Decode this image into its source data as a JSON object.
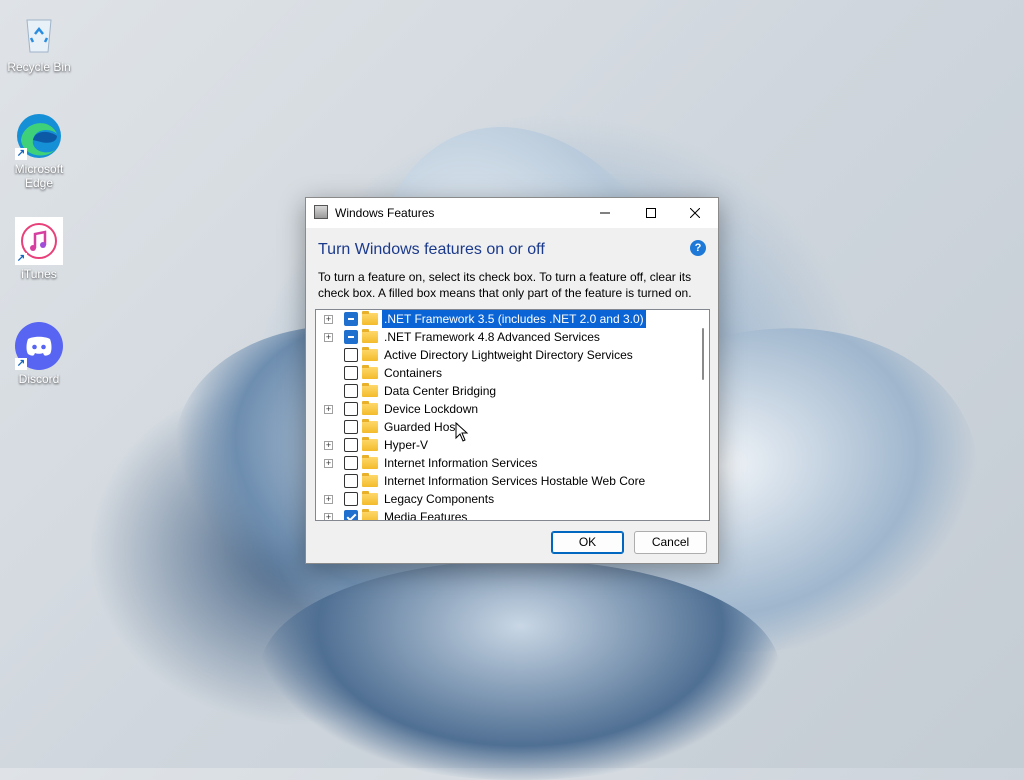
{
  "desktop": {
    "icons": [
      {
        "label": "Recycle Bin",
        "icon": "recycle-bin-icon"
      },
      {
        "label": "Microsoft Edge",
        "icon": "edge-icon",
        "shortcut": true
      },
      {
        "label": "iTunes",
        "icon": "itunes-icon",
        "shortcut": true
      },
      {
        "label": "Discord",
        "icon": "discord-icon",
        "shortcut": true
      }
    ]
  },
  "dialog": {
    "title": "Windows Features",
    "heading": "Turn Windows features on or off",
    "help_glyph": "?",
    "description": "To turn a feature on, select its check box. To turn a feature off, clear its check box. A filled box means that only part of the feature is turned on.",
    "features": [
      {
        "label": ".NET Framework 3.5 (includes .NET 2.0 and 3.0)",
        "state": "partial",
        "expandable": true,
        "selected": true
      },
      {
        "label": ".NET Framework 4.8 Advanced Services",
        "state": "partial",
        "expandable": true,
        "selected": false
      },
      {
        "label": "Active Directory Lightweight Directory Services",
        "state": "unchecked",
        "expandable": false,
        "selected": false
      },
      {
        "label": "Containers",
        "state": "unchecked",
        "expandable": false,
        "selected": false
      },
      {
        "label": "Data Center Bridging",
        "state": "unchecked",
        "expandable": false,
        "selected": false
      },
      {
        "label": "Device Lockdown",
        "state": "unchecked",
        "expandable": true,
        "selected": false
      },
      {
        "label": "Guarded Host",
        "state": "unchecked",
        "expandable": false,
        "selected": false
      },
      {
        "label": "Hyper-V",
        "state": "unchecked",
        "expandable": true,
        "selected": false
      },
      {
        "label": "Internet Information Services",
        "state": "unchecked",
        "expandable": true,
        "selected": false
      },
      {
        "label": "Internet Information Services Hostable Web Core",
        "state": "unchecked",
        "expandable": false,
        "selected": false
      },
      {
        "label": "Legacy Components",
        "state": "unchecked",
        "expandable": true,
        "selected": false
      },
      {
        "label": "Media Features",
        "state": "checked",
        "expandable": true,
        "selected": false
      }
    ],
    "ok_label": "OK",
    "cancel_label": "Cancel"
  },
  "colors": {
    "accent": "#0a64d6",
    "heading": "#1b3a8c"
  }
}
